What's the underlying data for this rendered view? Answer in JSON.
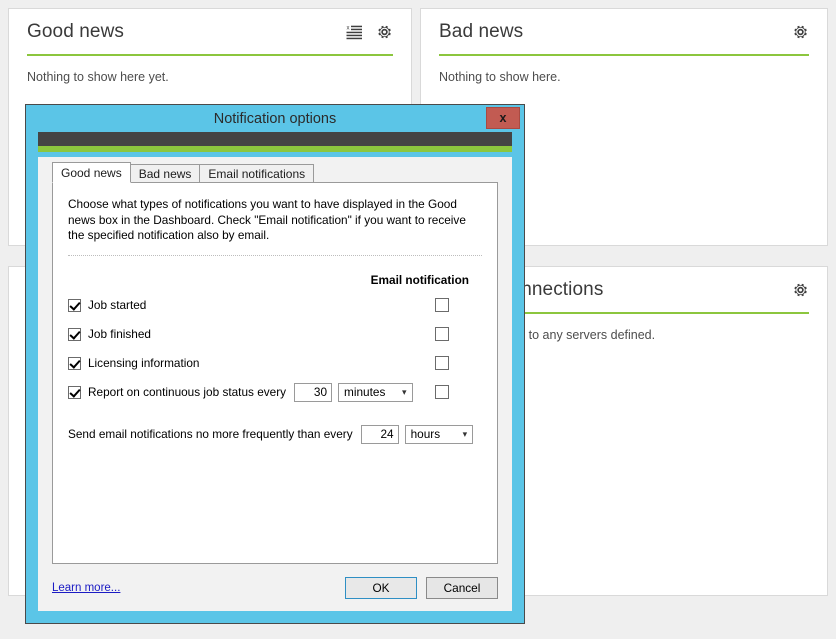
{
  "dashboard": {
    "panels": [
      {
        "id": "good-news",
        "title": "Good news",
        "body": "Nothing to show here yet.",
        "icons": [
          "clear-list-icon",
          "gear-icon"
        ]
      },
      {
        "id": "bad-news",
        "title": "Bad news",
        "body": "Nothing to show here.",
        "icons": [
          "gear-icon"
        ]
      },
      {
        "id": "left-lower",
        "title": "",
        "body": "",
        "icons": []
      },
      {
        "id": "server-connections",
        "title": "Server connections",
        "body": "No connections to any servers defined.",
        "icons": [
          "gear-icon"
        ]
      }
    ],
    "accent_green": "#8cc63e",
    "page_background": "#efefef"
  },
  "dialog": {
    "title": "Notification options",
    "close_label": "x",
    "accent_blue": "#5bc5e7",
    "close_color": "#c25b52",
    "tabs": [
      {
        "label": "Good news",
        "active": true
      },
      {
        "label": "Bad news",
        "active": false
      },
      {
        "label": "Email notifications",
        "active": false
      }
    ],
    "intro": "Choose what types of notifications you want to have displayed in the Good news box in the Dashboard. Check \"Email notification\" if you want to receive the specified notification also by email.",
    "email_column_header": "Email notification",
    "options": [
      {
        "label": "Job started",
        "checked": true,
        "email_checked": false
      },
      {
        "label": "Job finished",
        "checked": true,
        "email_checked": false
      },
      {
        "label": "Licensing information",
        "checked": true,
        "email_checked": false
      },
      {
        "label": "Report on continuous job status every",
        "checked": true,
        "email_checked": false,
        "interval_value": "30",
        "interval_unit": "minutes"
      }
    ],
    "frequency": {
      "label": "Send email notifications no more frequently than every",
      "value": "24",
      "unit": "hours"
    },
    "footer": {
      "learn_more": "Learn more...",
      "ok": "OK",
      "cancel": "Cancel"
    }
  }
}
